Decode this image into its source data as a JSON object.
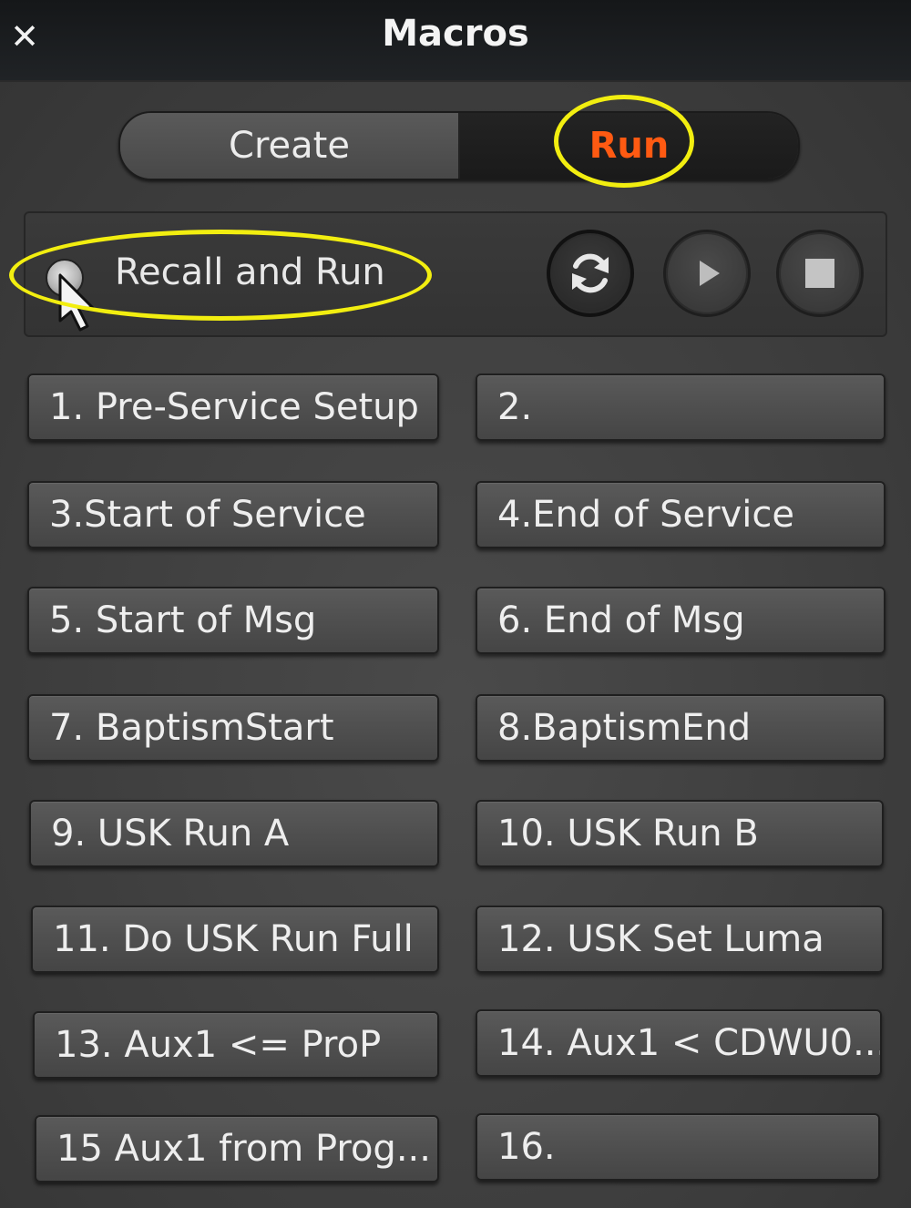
{
  "window": {
    "title": "Macros",
    "close_icon": "close-icon"
  },
  "mode_tabs": {
    "create_label": "Create",
    "run_label": "Run",
    "selected": "Run",
    "run_color": "#ff5a12"
  },
  "recall": {
    "label": "Recall and Run",
    "checked": false
  },
  "transport": {
    "loop_icon": "loop-icon",
    "play_icon": "play-icon",
    "stop_icon": "stop-icon"
  },
  "annotations": {
    "highlight_color": "#f2ee10"
  },
  "macros": [
    "1. Pre-Service Setup",
    "2.",
    "3.Start of Service",
    "4.End of Service",
    "5. Start of Msg",
    "6. End of Msg",
    "7. BaptismStart",
    "8.BaptismEnd",
    "9. USK Run A",
    "10. USK Run B",
    "11. Do USK Run Full",
    "12. USK Set Luma",
    "13. Aux1 <= ProP",
    "14. Aux1 < CDWU0...",
    "15 Aux1 from Prog...",
    "16."
  ]
}
